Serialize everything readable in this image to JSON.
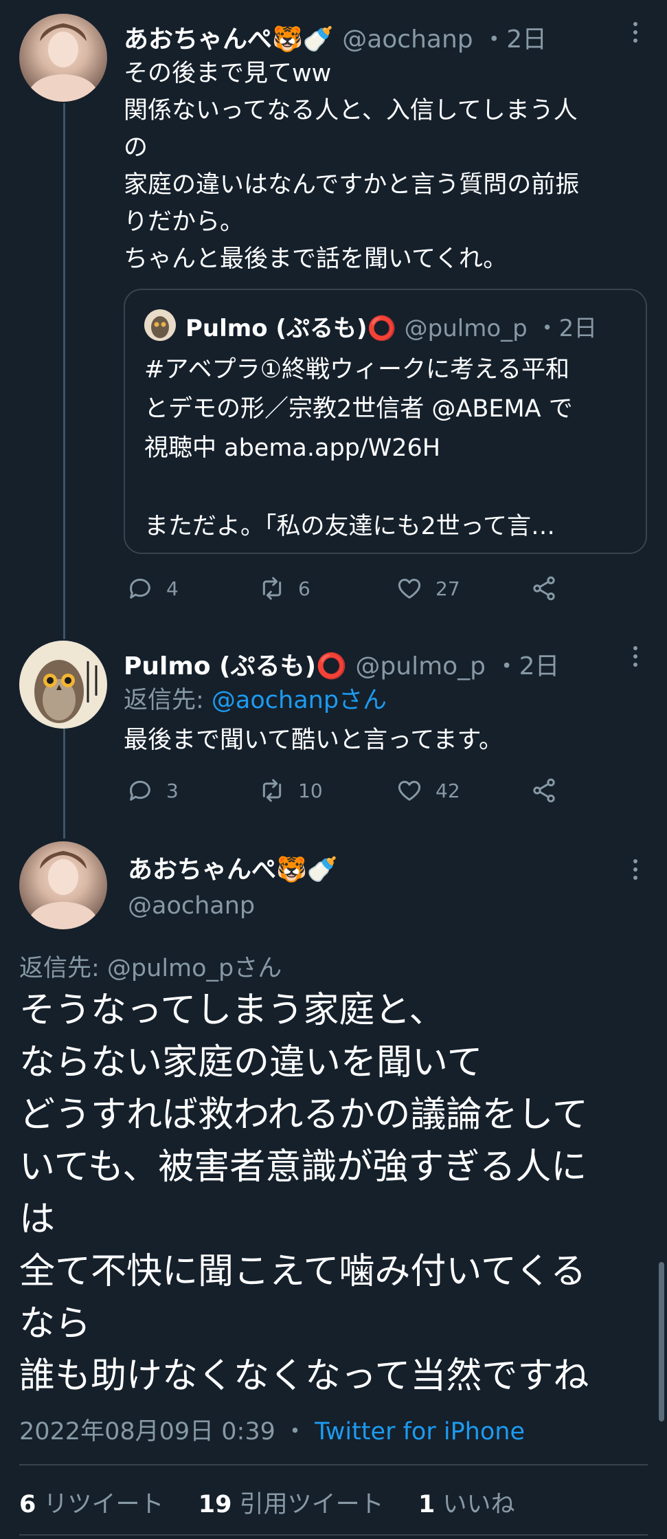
{
  "tweet1": {
    "display_name": "あおちゃんぺ🐯🍼",
    "handle": "@aochanp",
    "time": "・2日",
    "lines": [
      "その後まで見てww",
      "関係ないってなる人と、入信してしまう人",
      "の",
      "家庭の違いはなんですかと言う質問の前振",
      "りだから。",
      "ちゃんと最後まで話を聞いてくれ。"
    ],
    "quote": {
      "display_name": "Pulmo (ぷるも)⭕",
      "handle": "@pulmo_p",
      "time": "・2日",
      "lines": [
        "#アベプラ①終戦ウィークに考える平和",
        "とデモの形／宗教2世信者 @ABEMA で",
        "視聴中 abema.app/W26H",
        "",
        "まただよ。「私の友達にも2世って言…"
      ]
    },
    "replies": "4",
    "retweets": "6",
    "likes": "27"
  },
  "tweet2": {
    "display_name": "Pulmo (ぷるも)⭕",
    "handle": "@pulmo_p",
    "time": "・2日",
    "reply_prefix": "返信先: ",
    "reply_to": "@aochanpさん",
    "text": "最後まで聞いて酷いと言ってます。",
    "replies": "3",
    "retweets": "10",
    "likes": "42"
  },
  "main": {
    "display_name": "あおちゃんぺ🐯🍼",
    "handle": "@aochanp",
    "reply_to": "返信先: @pulmo_pさん",
    "lines": [
      "そうなってしまう家庭と、",
      "ならない家庭の違いを聞いて",
      "どうすれば救われるかの議論をして",
      "いても、被害者意識が強すぎる人に",
      "は",
      "全て不快に聞こえて噛み付いてくる",
      "なら",
      "誰も助けなくなくなって当然ですね"
    ],
    "timestamp": "2022年08月09日 0:39",
    "separator": "・",
    "source": "Twitter for iPhone",
    "stats": {
      "retweets_num": "6",
      "retweets_label": "リツイート",
      "quotes_num": "19",
      "quotes_label": "引用ツイート",
      "likes_num": "1",
      "likes_label": "いいね"
    }
  },
  "colors": {
    "background": "#15202b",
    "text": "#ffffff",
    "muted": "#8899a6",
    "link": "#1d9bf0",
    "border": "#38444d"
  }
}
